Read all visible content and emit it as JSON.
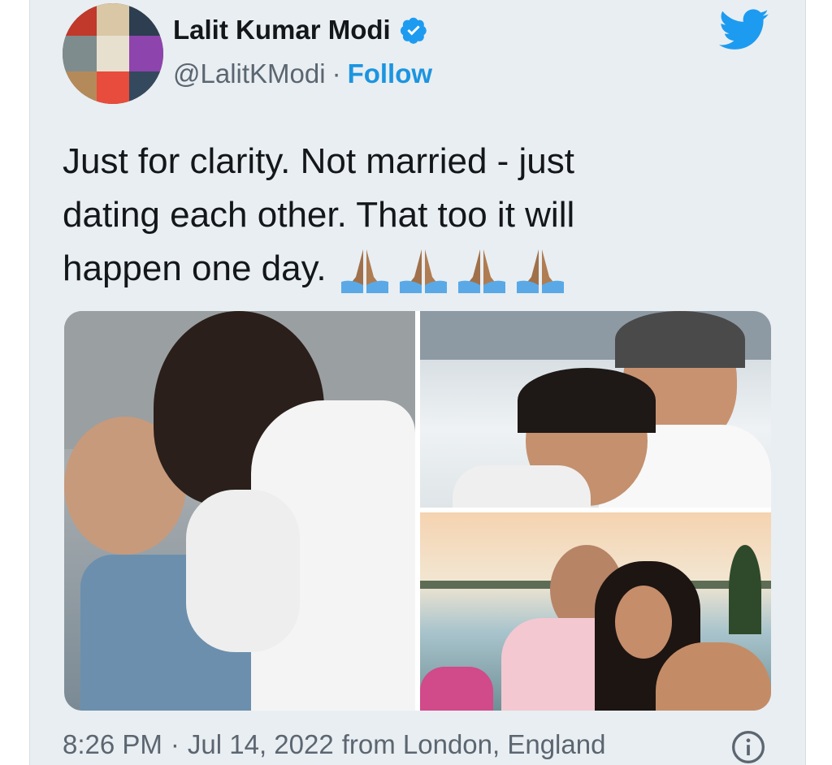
{
  "header": {
    "display_name": "Lalit Kumar Modi",
    "handle": "@LalitKModi",
    "separator": "·",
    "follow_label": "Follow",
    "verified_icon": "verified-badge-icon",
    "logo_icon": "twitter-bird-icon"
  },
  "tweet": {
    "text_line1": "Just for clarity. Not married - just",
    "text_line2": "dating each other. That too it will",
    "text_line3": "happen one day.",
    "emoji": [
      "folded-hands-emoji",
      "folded-hands-emoji",
      "folded-hands-emoji",
      "folded-hands-emoji"
    ]
  },
  "media": {
    "count": 3,
    "photos": [
      "photo-1",
      "photo-2",
      "photo-3"
    ]
  },
  "footer": {
    "time": "8:26 PM",
    "separator": "·",
    "date": "Jul 14, 2022",
    "source": "from London, England",
    "info_icon": "info-icon"
  },
  "colors": {
    "background": "#e9eef2",
    "text": "#14171a",
    "muted": "#5b6670",
    "accent": "#1b95e0"
  }
}
